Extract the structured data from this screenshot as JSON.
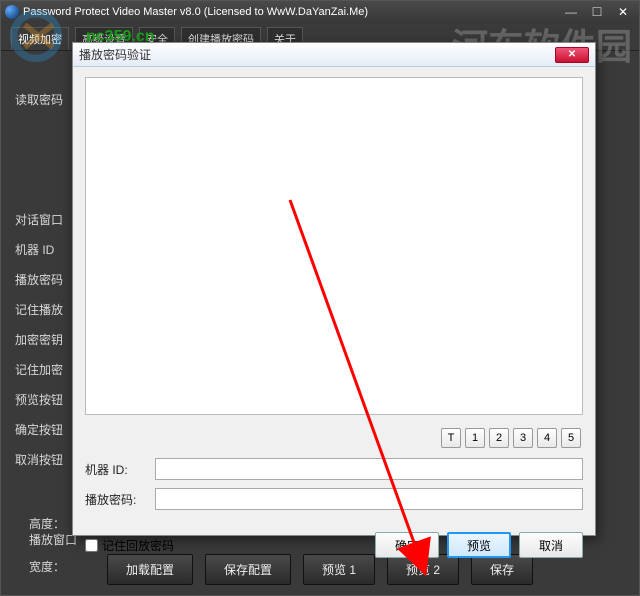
{
  "main": {
    "title": "Password Protect Video Master v8.0 (Licensed to WwW.DaYanZai.Me)",
    "tabs": [
      "视频加密",
      "高级设置",
      "安全",
      "创建播放密码",
      "关于"
    ],
    "active_tab": 0,
    "left_labels": [
      "读取密码",
      "对话窗口",
      "机器 ID",
      "播放密码",
      "记住播放",
      "加密密钥",
      "记住加密",
      "预览按钮",
      "确定按钮",
      "取消按钮"
    ],
    "lower_labels": [
      "播放窗口",
      "宽度：",
      "高度："
    ],
    "buttons": {
      "load": "加载配置",
      "save_cfg": "保存配置",
      "preview1": "预览 1",
      "preview2": "预览 2",
      "save": "保存"
    }
  },
  "modal": {
    "title": "播放密码验证",
    "digits": [
      "T",
      "1",
      "2",
      "3",
      "4",
      "5"
    ],
    "machine_id_label": "机器 ID:",
    "machine_id_value": "",
    "password_label": "播放密码:",
    "password_value": "",
    "remember_label": "记住回放密码",
    "ok": "确定",
    "preview": "预览",
    "cancel": "取消"
  },
  "watermark": {
    "url": "pc359.cn",
    "text": "河东软件园"
  }
}
